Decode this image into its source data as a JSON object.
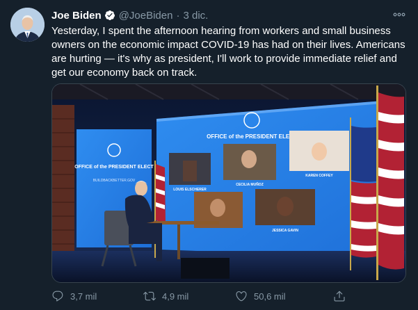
{
  "author": {
    "name": "Joe Biden",
    "handle": "@JoeBiden",
    "separator": "·",
    "date": "3 dic."
  },
  "tweet": {
    "text": "Yesterday, I spent the afternoon hearing from workers and small business owners on the economic impact COVID-19 has had on their lives. Americans are hurting — it's why as president, I'll work to provide immediate relief and get our economy back on track."
  },
  "media": {
    "left_screen_title": "OFFICE of the PRESIDENT ELECT",
    "left_screen_url": "BUILDBACKBETTER.GOV",
    "main_screen_title": "OFFICE of the PRESIDENT ELECT",
    "participants": [
      {
        "name": "LOUIS ELSCHERER"
      },
      {
        "name": "CECILIA MUÑOZ"
      },
      {
        "name": "KAREN COFFEY"
      },
      {
        "name": "JESSICA GAVIN"
      }
    ]
  },
  "actions": {
    "replies": "3,7 mil",
    "retweets": "4,9 mil",
    "likes": "50,6 mil"
  },
  "icons": {
    "avatar": "joe-biden-avatar",
    "verified": "verified-badge-icon",
    "more": "more-options-icon",
    "reply": "reply-icon",
    "retweet": "retweet-icon",
    "like": "heart-icon",
    "share": "share-icon"
  },
  "colors": {
    "background": "#15202b",
    "secondary_text": "#8899a6",
    "accent_blue": "#1da1f2"
  }
}
